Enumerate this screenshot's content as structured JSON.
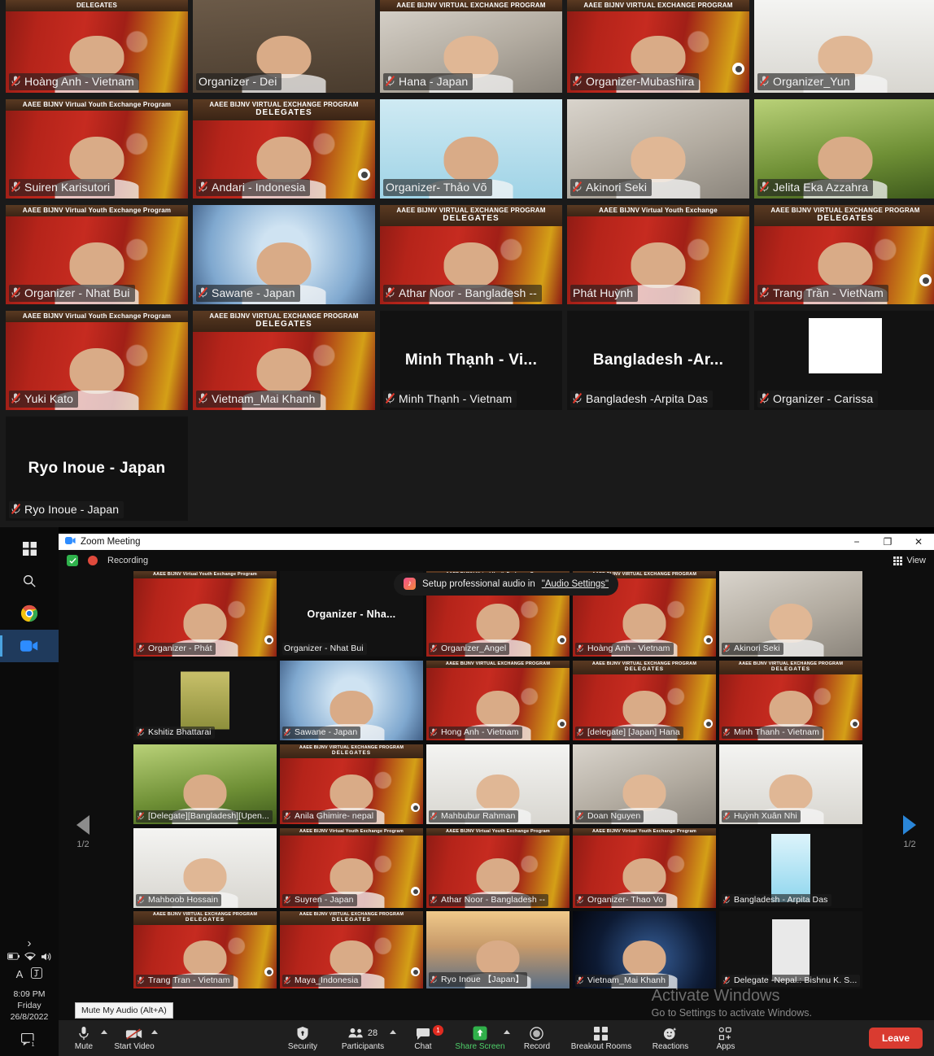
{
  "gallery_top": {
    "banner_line1": "AAEE BIJNV Virtual Youth Exchange Program",
    "banner_line2": "DELEGATES",
    "banner_alt1": "AAEE BIJNV VIRTUAL EXCHANGE PROGRAM",
    "rows": [
      {
        "tiles": [
          {
            "name": "Hoàng Anh - Vietnam",
            "bg": "flagbg",
            "banner": "alt2",
            "selected": false,
            "muted": true
          },
          {
            "name": "Organizer - Dei",
            "bg": "tan",
            "banner": "none",
            "selected": true,
            "muted": false
          },
          {
            "name": "Hana - Japan",
            "bg": "roombg",
            "banner": "alt1",
            "selected": false,
            "muted": true
          },
          {
            "name": "Organizer-Mubashira",
            "bg": "flagbg",
            "banner": "alt1",
            "selected": false,
            "muted": true,
            "reaction": true
          },
          {
            "name": "Organizer_Yun",
            "bg": "whitebg",
            "banner": "none",
            "selected": false,
            "muted": true
          }
        ]
      },
      {
        "tiles": [
          {
            "name": "Suiren Karisutori",
            "bg": "flagbg",
            "banner": "line1",
            "selected": false,
            "muted": true
          },
          {
            "name": "Andari - Indonesia",
            "bg": "flagbg",
            "banner": "delegates",
            "selected": false,
            "muted": true,
            "reaction": true
          },
          {
            "name": "Organizer- Thảo Võ",
            "bg": "skyblue",
            "banner": "none",
            "selected": false,
            "muted": false
          },
          {
            "name": "Akinori Seki",
            "bg": "roombg",
            "banner": "none",
            "selected": false,
            "muted": true
          },
          {
            "name": "Jelita Eka Azzahra",
            "bg": "greenbg",
            "banner": "none",
            "selected": false,
            "muted": true
          }
        ]
      },
      {
        "tiles": [
          {
            "name": "Organizer - Nhat Bui",
            "bg": "flagbg",
            "banner": "line1",
            "selected": false,
            "muted": true
          },
          {
            "name": "Sawane - Japan",
            "bg": "blurblue",
            "banner": "none",
            "selected": false,
            "muted": true
          },
          {
            "name": "Athar Noor - Bangladesh --",
            "bg": "flagbg",
            "banner": "delegates",
            "selected": false,
            "muted": true
          },
          {
            "name": "Phát Huỳnh",
            "bg": "flagbg",
            "banner": "alt3",
            "selected": false,
            "muted": false
          },
          {
            "name": "Trang Trần - VietNam",
            "bg": "flagbg",
            "banner": "delegates",
            "selected": false,
            "muted": true,
            "reaction": true
          }
        ]
      },
      {
        "tiles": [
          {
            "name": "Yuki Kato",
            "bg": "flagbg",
            "banner": "line1",
            "selected": false,
            "muted": true
          },
          {
            "name": "Vietnam_Mai Khanh",
            "bg": "flagbg",
            "banner": "delegates",
            "selected": false,
            "muted": true
          },
          {
            "name": "Minh Thạnh - Vietnam",
            "bigname": "Minh Thạnh - Vi...",
            "bg": "dark",
            "banner": "none",
            "selected": false,
            "muted": true
          },
          {
            "name": "Bangladesh -Arpita Das",
            "bigname": "Bangladesh  -Ar...",
            "bg": "dark",
            "banner": "none",
            "selected": false,
            "muted": true
          },
          {
            "name": "Organizer - Carissa",
            "bg": "dark",
            "banner": "none",
            "selected": false,
            "muted": true,
            "whitebox": true
          }
        ]
      },
      {
        "tiles": [
          {
            "name": "Ryo Inoue - Japan",
            "bigname": "Ryo Inoue - Japan",
            "bg": "dark",
            "banner": "none",
            "selected": false,
            "muted": true
          }
        ]
      }
    ]
  },
  "taskbar": {
    "start_label": "Start",
    "search_label": "Search",
    "chrome_label": "Google Chrome",
    "zoom_label": "Zoom",
    "tray": {
      "chevron": "›",
      "battery": "battery-icon",
      "wifi": "wifi-icon",
      "volume": "volume-icon",
      "lang": "A",
      "ime": "ime-icon",
      "time": "8:09 PM",
      "day": "Friday",
      "date": "26/8/2022",
      "notifications": "notifications-icon",
      "notification_count": "1"
    }
  },
  "window": {
    "title": "Zoom Meeting",
    "minimize": "−",
    "maximize": "❐",
    "close": "✕",
    "encryption_status": "encrypted",
    "recording_label": "Recording",
    "view_label": "View",
    "toast": {
      "text_before": "Setup professional audio in",
      "link_text": "\"Audio Settings\""
    },
    "pager": {
      "left_label": "1/2",
      "right_label": "1/2"
    }
  },
  "gallery_window": {
    "rows": [
      {
        "tiles": [
          {
            "name": "Organizer - Phát",
            "bg": "flagbg",
            "banner": "line1",
            "selected": false,
            "muted": true,
            "reaction": true
          },
          {
            "name": "Organizer - Nhat Bui",
            "bigname": "Organizer  -  Nha...",
            "bg": "dark",
            "banner": "none",
            "selected": true,
            "muted": false
          },
          {
            "name": "Organizer_Angel",
            "bg": "flagbg",
            "banner": "line1",
            "selected": false,
            "muted": true,
            "reaction": true
          },
          {
            "name": "Hoàng Anh - Vietnam",
            "bg": "flagbg",
            "banner": "alt1",
            "selected": false,
            "muted": true,
            "reaction": true
          },
          {
            "name": "Akinori Seki",
            "bg": "roombg",
            "banner": "none",
            "selected": false,
            "muted": true
          }
        ]
      },
      {
        "tiles": [
          {
            "name": "Kshitiz Bhattarai",
            "bg": "dark",
            "banner": "none",
            "selected": false,
            "muted": true,
            "avatar": "photo"
          },
          {
            "name": "Sawane - Japan",
            "bg": "blurblue",
            "banner": "none",
            "selected": false,
            "muted": true
          },
          {
            "name": "Hong Anh - Vietnam",
            "bg": "flagbg",
            "banner": "alt1",
            "selected": false,
            "muted": true,
            "reaction": true
          },
          {
            "name": "[delegate] [Japan] Hana",
            "bg": "flagbg",
            "banner": "delegates",
            "selected": false,
            "muted": true,
            "reaction": true
          },
          {
            "name": "Minh Thanh - Vietnam",
            "bg": "flagbg",
            "banner": "delegates",
            "selected": false,
            "muted": true,
            "reaction": true
          }
        ]
      },
      {
        "tiles": [
          {
            "name": "[Delegate][Bangladesh][Upen...",
            "bg": "greenbg",
            "banner": "none",
            "selected": false,
            "muted": true
          },
          {
            "name": "Anila Ghimire- nepal",
            "bg": "flagbg",
            "banner": "delegates",
            "selected": false,
            "muted": true,
            "reaction": true
          },
          {
            "name": "Mahbubur Rahman",
            "bg": "whitebg",
            "banner": "none",
            "selected": false,
            "muted": true
          },
          {
            "name": "Doan Nguyen",
            "bg": "roombg",
            "banner": "none",
            "selected": false,
            "muted": true
          },
          {
            "name": "Huỳnh Xuân Nhi",
            "bg": "whitebg",
            "banner": "none",
            "selected": false,
            "muted": true
          }
        ]
      },
      {
        "tiles": [
          {
            "name": "Mahboob Hossain",
            "bg": "whitebg",
            "banner": "none",
            "selected": false,
            "muted": true
          },
          {
            "name": "Suyren - Japan",
            "bg": "flagbg",
            "banner": "line1",
            "selected": false,
            "muted": true,
            "reaction": true
          },
          {
            "name": "Athar Noor - Bangladesh --",
            "bg": "flagbg",
            "banner": "line1",
            "selected": false,
            "muted": true
          },
          {
            "name": "Organizer- Thao Vo",
            "bg": "flagbg",
            "banner": "line1",
            "selected": false,
            "muted": true
          },
          {
            "name": "Bangladesh - Arpita Das",
            "bg": "dark",
            "banner": "none",
            "selected": false,
            "muted": true,
            "avatar": "skyphoto"
          }
        ]
      },
      {
        "tiles": [
          {
            "name": "Trang Tran - Vietnam",
            "bg": "flagbg",
            "banner": "delegates",
            "selected": false,
            "muted": true,
            "reaction": true
          },
          {
            "name": "Maya_Indonesia",
            "bg": "flagbg",
            "banner": "delegates",
            "selected": false,
            "muted": true,
            "reaction": true
          },
          {
            "name": "Ryo Inoue 【Japan】",
            "bg": "bridgebg",
            "banner": "none",
            "selected": false,
            "muted": true
          },
          {
            "name": "Vietnam_Mai Khanh",
            "bg": "nightsky",
            "banner": "none",
            "selected": false,
            "muted": true
          },
          {
            "name": "Delegate -Nepal.: Bishnu K. S...",
            "bg": "dark",
            "banner": "none",
            "selected": false,
            "muted": true,
            "avatar": "mickey"
          }
        ]
      }
    ]
  },
  "toolbar": {
    "mute_tooltip": "Mute My Audio (Alt+A)",
    "mute_label": "Mute",
    "video_label": "Start Video",
    "security_label": "Security",
    "participants_label": "Participants",
    "participants_count": "28",
    "chat_label": "Chat",
    "chat_badge": "1",
    "share_label": "Share Screen",
    "record_label": "Record",
    "breakout_label": "Breakout Rooms",
    "reactions_label": "Reactions",
    "apps_label": "Apps",
    "leave_label": "Leave"
  },
  "watermark": {
    "line1": "Activate Windows",
    "line2": "Go to Settings to activate Windows."
  }
}
